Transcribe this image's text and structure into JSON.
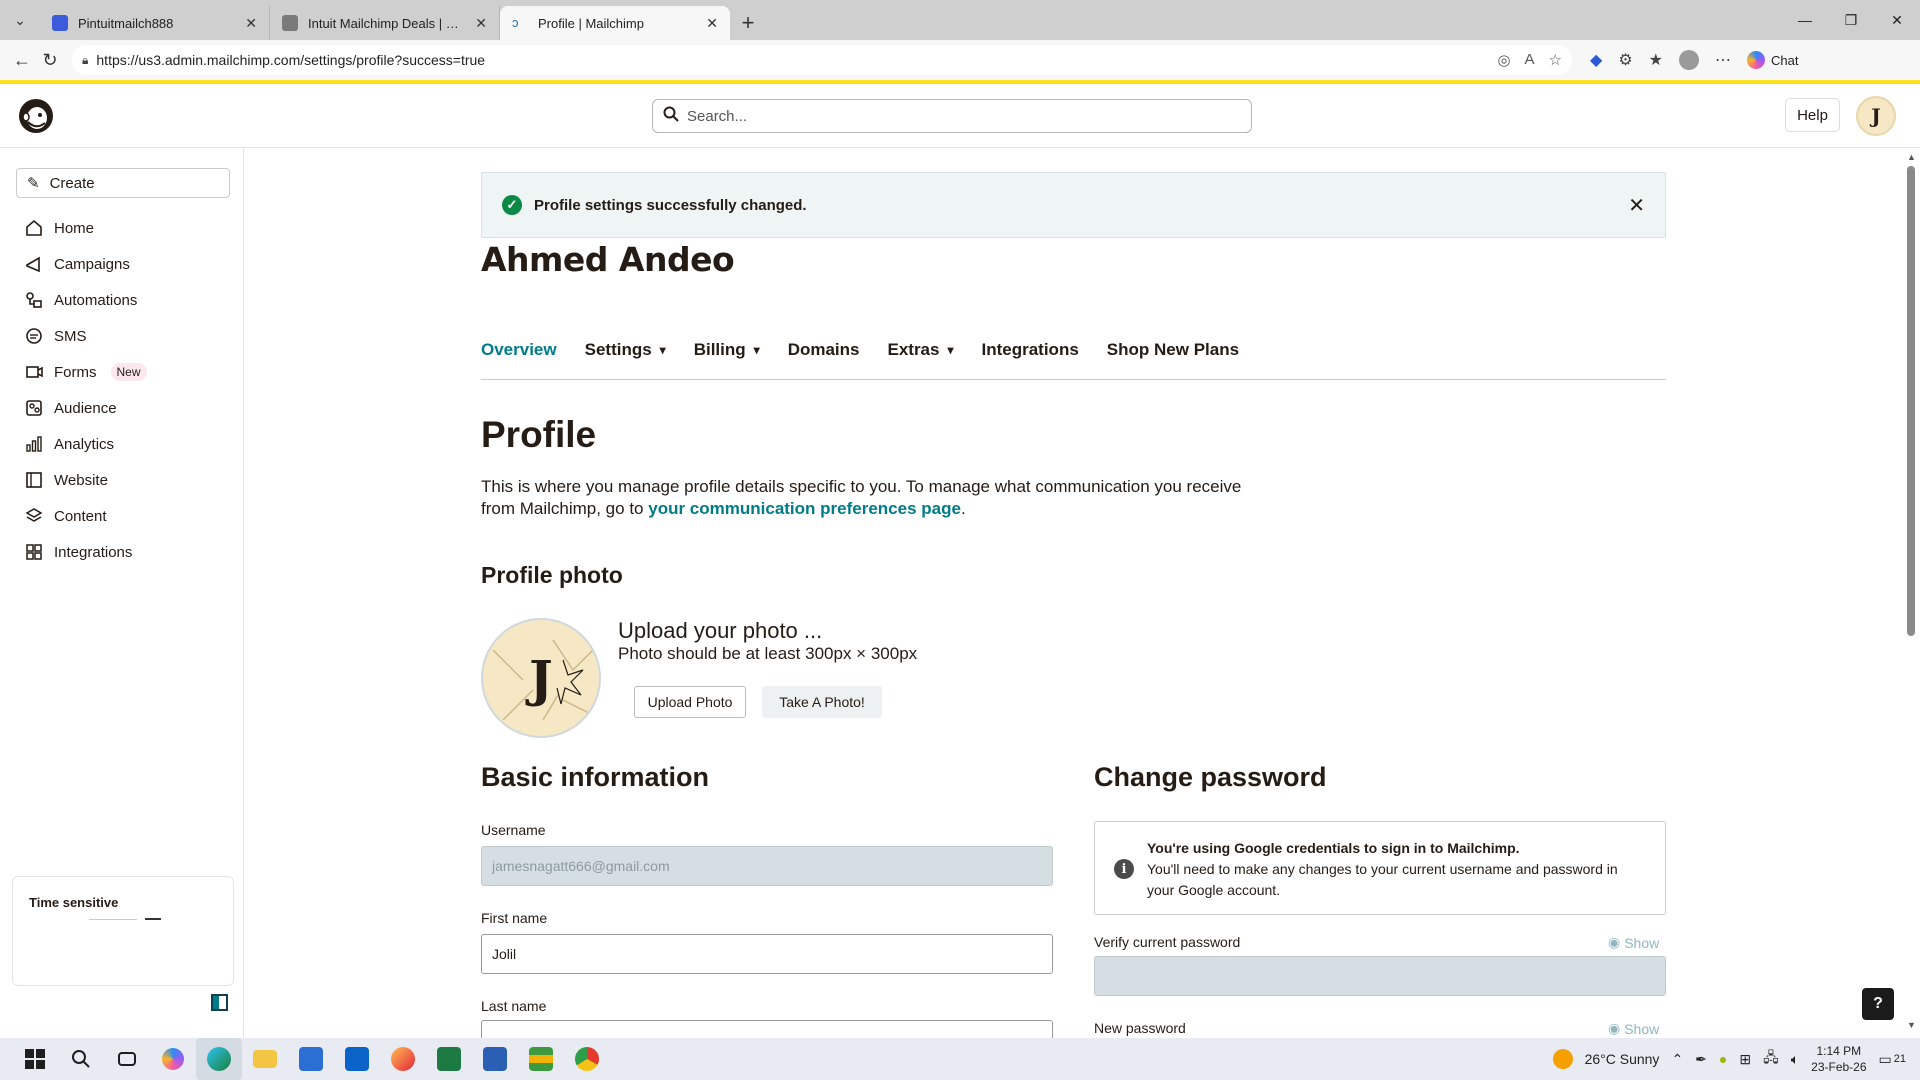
{
  "browser": {
    "tabs": [
      {
        "title": "Pintuitmailch888",
        "favicon_color": "#3b5bdb"
      },
      {
        "title": "Intuit Mailchimp Deals | Free Trial",
        "favicon_color": "#7a7a7a"
      },
      {
        "title": "Profile | Mailchimp",
        "favicon_color": "#2b6cb0"
      }
    ],
    "url": "https://us3.admin.mailchimp.com/settings/profile?success=true",
    "chat_label": "Chat"
  },
  "header": {
    "search_placeholder": "Search...",
    "help_label": "Help",
    "avatar_initial": "J"
  },
  "sidebar": {
    "create_label": "Create",
    "items": [
      {
        "label": "Home",
        "icon": "home-icon"
      },
      {
        "label": "Campaigns",
        "icon": "megaphone-icon"
      },
      {
        "label": "Automations",
        "icon": "automation-icon"
      },
      {
        "label": "SMS",
        "icon": "sms-icon"
      },
      {
        "label": "Forms",
        "icon": "forms-icon",
        "badge": "New"
      },
      {
        "label": "Audience",
        "icon": "audience-icon"
      },
      {
        "label": "Analytics",
        "icon": "analytics-icon"
      },
      {
        "label": "Website",
        "icon": "website-icon"
      },
      {
        "label": "Content",
        "icon": "content-icon"
      },
      {
        "label": "Integrations",
        "icon": "integrations-icon"
      }
    ],
    "time_sensitive_label": "Time sensitive"
  },
  "main": {
    "banner_text": "Profile settings successfully changed.",
    "account_name": "Ahmed Andeo",
    "tabs": [
      {
        "label": "Overview",
        "dropdown": false,
        "active": true
      },
      {
        "label": "Settings",
        "dropdown": true
      },
      {
        "label": "Billing",
        "dropdown": true
      },
      {
        "label": "Domains",
        "dropdown": false
      },
      {
        "label": "Extras",
        "dropdown": true
      },
      {
        "label": "Integrations",
        "dropdown": false
      },
      {
        "label": "Shop New Plans",
        "dropdown": false
      }
    ],
    "page_title": "Profile",
    "description": "This is where you manage profile details specific to you. To manage what communication you receive from Mailchimp, go to",
    "description_link": "your communication preferences page",
    "description_end": ".",
    "profile_photo_heading": "Profile photo",
    "photo_initial": "J",
    "upload_title": "Upload your photo ...",
    "upload_hint": "Photo should be at least 300px × 300px",
    "upload_button": "Upload Photo",
    "take_photo_button": "Take A Photo!",
    "basic_info_heading": "Basic information",
    "username_label": "Username",
    "username_value": "jamesnagatt666@gmail.com",
    "first_name_label": "First name",
    "first_name_value": "Jolil",
    "last_name_label": "Last name",
    "change_password_heading": "Change password",
    "info_title": "You're using Google credentials to sign in to Mailchimp.",
    "info_body": "You'll need to make any changes to your current username and password in your Google account.",
    "verify_password_label": "Verify current password",
    "new_password_label": "New password",
    "show_label": "Show"
  },
  "taskbar": {
    "weather": "26°C  Sunny",
    "time": "1:14 PM",
    "date": "23-Feb-26",
    "notifications": "21"
  }
}
